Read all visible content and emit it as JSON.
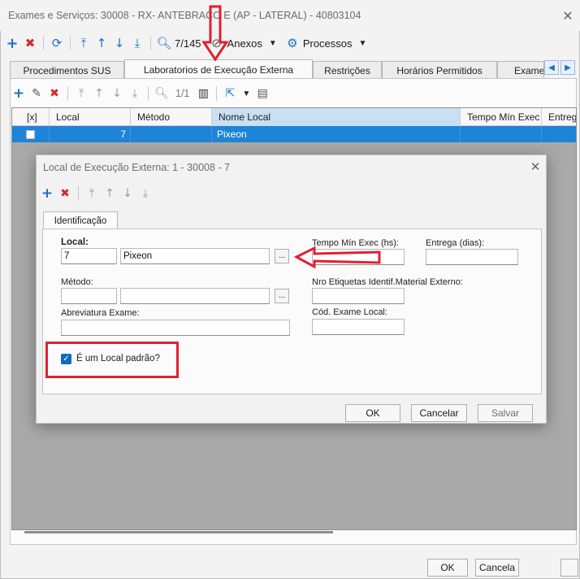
{
  "window": {
    "title": "Exames e Serviços: 30008 - RX- ANTEBRACO E (AP - LATERAL) - 40803104"
  },
  "toolbar": {
    "record_position": "7/145",
    "anexos_label": "Anexos",
    "processos_label": "Processos"
  },
  "tabs": [
    {
      "label": "Procedimentos SUS"
    },
    {
      "label": "Laboratorios de Execução Externa"
    },
    {
      "label": "Restrições"
    },
    {
      "label": "Horários Permitidos"
    },
    {
      "label": "Exame"
    }
  ],
  "subtoolbar": {
    "page_position": "1/1"
  },
  "grid": {
    "columns": [
      "[x]",
      "Local",
      "Método",
      "Nome Local",
      "Tempo Mín Exec",
      "Entreg"
    ],
    "rows": [
      {
        "checked": false,
        "local": "7",
        "metodo": "",
        "nome_local": "Pixeon",
        "tempo": "",
        "entrega": ""
      }
    ]
  },
  "footer": {
    "ok_label": "OK",
    "cancel_label": "Cancela"
  },
  "dialog": {
    "title": "Local de Execução Externa: 1 - 30008 - 7",
    "tab_label": "Identificação",
    "local_label": "Local:",
    "local_code": "7",
    "local_name": "Pixeon",
    "metodo_label": "Método:",
    "metodo_code": "",
    "metodo_name": "",
    "abreviatura_label": "Abreviatura Exame:",
    "abreviatura_value": "",
    "tempo_label": "Tempo Mín Exec (hs):",
    "tempo_value": "",
    "entrega_label": "Entrega (dias):",
    "entrega_value": "",
    "nro_etiquetas_label": "Nro Etiquetas Identif.Material Externo:",
    "nro_etiquetas_value": "",
    "cod_exame_label": "Cód. Exame Local:",
    "cod_exame_value": "",
    "local_padrao_label": "É um Local padrão?",
    "local_padrao_checked": true,
    "ok_label": "OK",
    "cancel_label": "Cancelar",
    "save_label": "Salvar",
    "ellipsis": "..."
  },
  "colors": {
    "accent": "#1e84d8",
    "annotation": "#e02030"
  }
}
